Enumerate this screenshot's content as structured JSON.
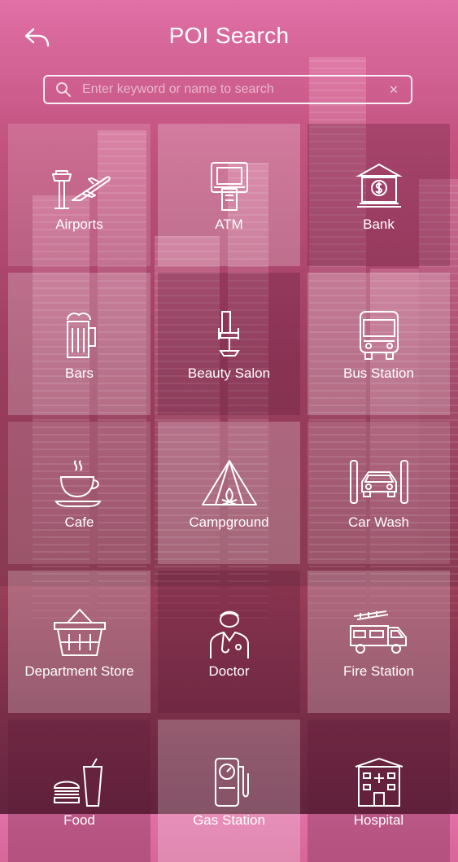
{
  "header": {
    "title": "POI Search"
  },
  "search": {
    "placeholder": "Enter keyword or name to search",
    "clear_label": "×"
  },
  "categories": [
    {
      "label": "Airports",
      "icon": "airport-icon"
    },
    {
      "label": "ATM",
      "icon": "atm-icon"
    },
    {
      "label": "Bank",
      "icon": "bank-icon"
    },
    {
      "label": "Bars",
      "icon": "beer-mug-icon"
    },
    {
      "label": "Beauty Salon",
      "icon": "salon-chair-icon"
    },
    {
      "label": "Bus Station",
      "icon": "bus-icon"
    },
    {
      "label": "Cafe",
      "icon": "coffee-cup-icon"
    },
    {
      "label": "Campground",
      "icon": "tent-icon"
    },
    {
      "label": "Car Wash",
      "icon": "car-wash-icon"
    },
    {
      "label": "Department Store",
      "icon": "basket-icon"
    },
    {
      "label": "Doctor",
      "icon": "doctor-icon"
    },
    {
      "label": "Fire Station",
      "icon": "fire-truck-icon"
    },
    {
      "label": "Food",
      "icon": "burger-drink-icon"
    },
    {
      "label": "Gas Station",
      "icon": "gas-pump-icon"
    },
    {
      "label": "Hospital",
      "icon": "hospital-icon"
    }
  ]
}
